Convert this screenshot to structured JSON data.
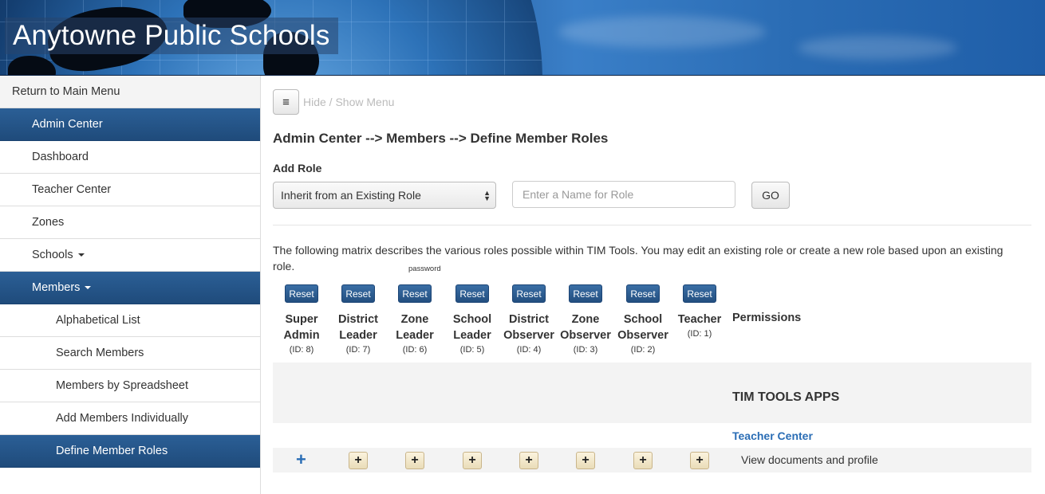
{
  "banner": {
    "title": "Anytowne Public Schools"
  },
  "sidebar": {
    "return_label": "Return to Main Menu",
    "items": [
      {
        "label": "Admin Center",
        "level": 1,
        "active": true,
        "caret": false
      },
      {
        "label": "Dashboard",
        "level": 1,
        "active": false,
        "caret": false
      },
      {
        "label": "Teacher Center",
        "level": 1,
        "active": false,
        "caret": false
      },
      {
        "label": "Zones",
        "level": 1,
        "active": false,
        "caret": false
      },
      {
        "label": "Schools",
        "level": 1,
        "active": false,
        "caret": true
      },
      {
        "label": "Members",
        "level": 1,
        "active": true,
        "caret": true
      },
      {
        "label": "Alphabetical List",
        "level": 2,
        "active": false,
        "caret": false
      },
      {
        "label": "Search Members",
        "level": 2,
        "active": false,
        "caret": false
      },
      {
        "label": "Members by Spreadsheet",
        "level": 2,
        "active": false,
        "caret": false
      },
      {
        "label": "Add Members Individually",
        "level": 2,
        "active": false,
        "caret": false
      },
      {
        "label": "Define Member Roles",
        "level": 2,
        "active": true,
        "caret": false
      }
    ]
  },
  "toolbar": {
    "menu_icon": "≡",
    "toggle_label": "Hide / Show Menu"
  },
  "main": {
    "title": "Admin Center --> Members --> Define Member Roles",
    "add_role_label": "Add Role",
    "inherit_select_value": "Inherit from an Existing Role",
    "role_name_placeholder": "Enter a Name for Role",
    "go_label": "GO",
    "description": "The following matrix describes the various roles possible within TIM Tools. You may edit an existing role or create a new role based upon an existing role.",
    "password_label": "password",
    "reset_label": "Reset",
    "permissions_label": "Permissions",
    "roles": [
      {
        "line1": "Super",
        "line2": "Admin",
        "id": "(ID: 8)"
      },
      {
        "line1": "District",
        "line2": "Leader",
        "id": "(ID: 7)"
      },
      {
        "line1": "Zone",
        "line2": "Leader",
        "id": "(ID: 6)"
      },
      {
        "line1": "School",
        "line2": "Leader",
        "id": "(ID: 5)"
      },
      {
        "line1": "District",
        "line2": "Observer",
        "id": "(ID: 4)"
      },
      {
        "line1": "Zone",
        "line2": "Observer",
        "id": "(ID: 3)"
      },
      {
        "line1": "School",
        "line2": "Observer",
        "id": "(ID: 2)"
      },
      {
        "line1": "Teacher",
        "line2": "",
        "id": "(ID: 1)"
      }
    ],
    "apps_heading": "TIM TOOLS APPS",
    "section_link": "Teacher Center",
    "plus_symbol": "+",
    "permission_rows": [
      {
        "text": "View documents and profile"
      }
    ]
  },
  "colors": {
    "active_nav": "#1f4b7b",
    "link": "#2a6db5",
    "reset_button": "#234f80"
  }
}
